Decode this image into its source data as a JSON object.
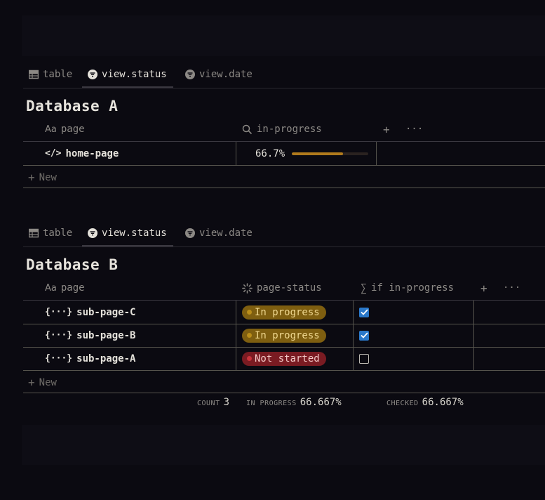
{
  "tabs": [
    {
      "label": "table",
      "icon": "table-icon"
    },
    {
      "label": "view.status",
      "icon": "filter-icon"
    },
    {
      "label": "view.date",
      "icon": "filter-icon"
    }
  ],
  "database_a": {
    "title": "Database A",
    "columns": {
      "page": "page",
      "page_prefix": "Aa",
      "in_progress": "in-progress"
    },
    "rows": [
      {
        "name": "home-page",
        "icon": "code-icon",
        "in_progress_label": "66.7%",
        "in_progress_value": 0.667
      }
    ],
    "new_label": "New"
  },
  "database_b": {
    "title": "Database B",
    "columns": {
      "page": "page",
      "page_prefix": "Aa",
      "status": "page-status",
      "formula": "if in-progress"
    },
    "rows": [
      {
        "name": "sub-page-C",
        "icon": "braces-icon",
        "status": "In progress",
        "checked": true
      },
      {
        "name": "sub-page-B",
        "icon": "braces-icon",
        "status": "In progress",
        "checked": true
      },
      {
        "name": "sub-page-A",
        "icon": "braces-icon",
        "status": "Not started",
        "checked": false
      }
    ],
    "new_label": "New",
    "footer": {
      "count_label": "COUNT",
      "count_value": "3",
      "in_progress_label": "IN PROGRESS",
      "in_progress_value": "66.667%",
      "checked_label": "CHECKED",
      "checked_value": "66.667%"
    }
  },
  "colors": {
    "in_progress_badge": "#7e5e10",
    "not_started_badge": "#7a1b22",
    "checkbox_on": "#2a78c9",
    "progress_fill": "#b07a1c"
  }
}
